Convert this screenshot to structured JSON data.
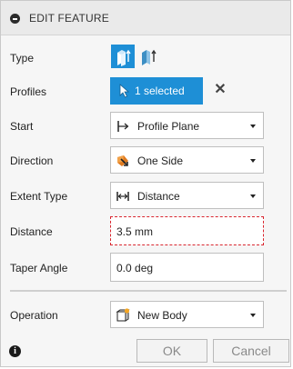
{
  "title": "EDIT FEATURE",
  "fields": {
    "type": {
      "label": "Type"
    },
    "profiles": {
      "label": "Profiles",
      "value": "1 selected"
    },
    "start": {
      "label": "Start",
      "value": "Profile Plane",
      "icon": "profile-plane-icon"
    },
    "direction": {
      "label": "Direction",
      "value": "One Side",
      "icon": "one-side-icon"
    },
    "extent_type": {
      "label": "Extent Type",
      "value": "Distance",
      "icon": "distance-icon"
    },
    "distance": {
      "label": "Distance",
      "value": "3.5 mm",
      "state": "invalid"
    },
    "taper_angle": {
      "label": "Taper Angle",
      "value": "0.0 deg"
    },
    "operation": {
      "label": "Operation",
      "value": "New Body",
      "icon": "new-body-icon"
    }
  },
  "buttons": {
    "ok": "OK",
    "cancel": "Cancel"
  },
  "colors": {
    "accent": "#1e8fd6",
    "error": "#d9262f"
  }
}
